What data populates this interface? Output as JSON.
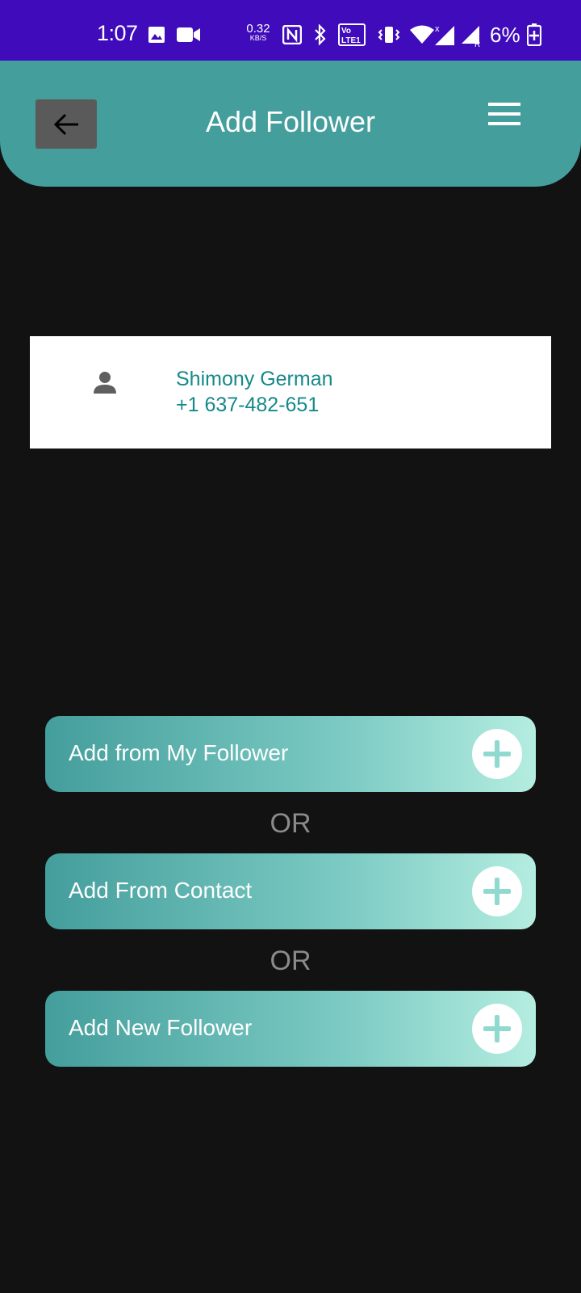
{
  "status_bar": {
    "time": "1:07",
    "net_speed_value": "0.32",
    "net_speed_unit": "KB/S",
    "battery": "6%",
    "icons": [
      "gallery-icon",
      "video-icon",
      "nfc-icon",
      "bluetooth-icon",
      "volte-icon",
      "vibrate-icon",
      "wifi-icon",
      "signal-icon",
      "signal-roaming-icon",
      "battery-icon"
    ]
  },
  "header": {
    "title": "Add Follower",
    "back_icon": "arrow-left-icon",
    "menu_icon": "hamburger-menu-icon"
  },
  "contact": {
    "name": "Shimony German",
    "phone": "+1 637-482-651",
    "icon": "person-icon"
  },
  "actions": [
    {
      "label": "Add from My Follower",
      "icon": "plus-icon"
    },
    {
      "label": "Add From Contact",
      "icon": "plus-icon"
    },
    {
      "label": "Add New Follower",
      "icon": "plus-icon"
    }
  ],
  "separator": "OR",
  "colors": {
    "status_bar": "#3f0bbb",
    "header": "#449e9c",
    "background": "#121212",
    "contact_text": "#15898a",
    "gradient_start": "#449e9c",
    "gradient_end": "#b5ede0"
  }
}
